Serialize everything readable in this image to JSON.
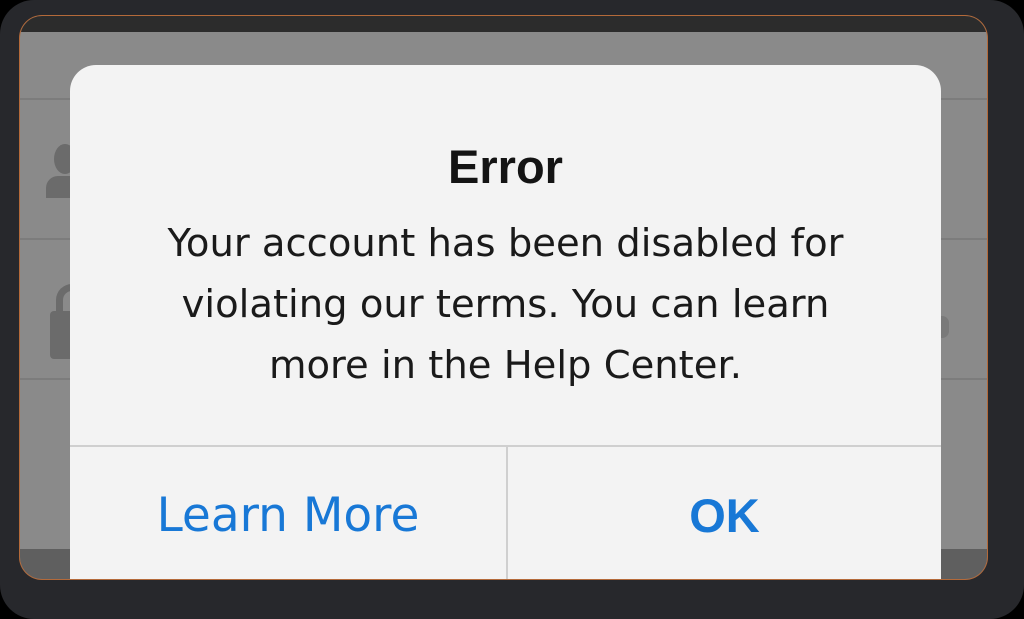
{
  "alert": {
    "title": "Error",
    "message": "Your account has been disabled for violating our terms. You can learn more in the Help Center.",
    "buttons": {
      "learn_more": "Learn More",
      "ok": "OK"
    }
  },
  "colors": {
    "button_text": "#1878d6",
    "alert_background": "#f3f3f3",
    "dimmed_background": "#8a8a8a"
  },
  "icons": [
    "user-icon",
    "lock-icon"
  ]
}
